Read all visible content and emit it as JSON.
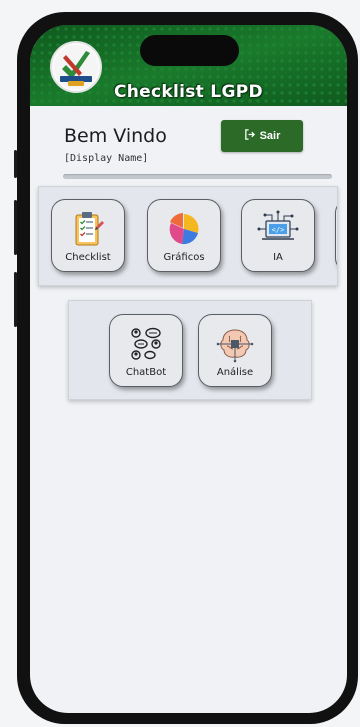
{
  "header": {
    "title": "Checklist LGPD",
    "logo_icon": "lgpd-check-logo-icon"
  },
  "welcome": {
    "heading": "Bem Vindo",
    "display_name": "[Display Name]"
  },
  "sair_button": {
    "label": "Sair",
    "icon": "logout-icon"
  },
  "menu_row1": [
    {
      "label": "Checklist",
      "icon": "clipboard-checklist-icon"
    },
    {
      "label": "Gráficos",
      "icon": "pie-chart-icon"
    },
    {
      "label": "IA",
      "icon": "ai-circuit-icon"
    }
  ],
  "menu_row2": [
    {
      "label": "ChatBot",
      "icon": "chat-bubbles-icon"
    },
    {
      "label": "Análise",
      "icon": "brain-chip-icon"
    }
  ],
  "colors": {
    "header_green": "#156b26",
    "button_green": "#2b6a27",
    "background": "#f0f2f6"
  }
}
